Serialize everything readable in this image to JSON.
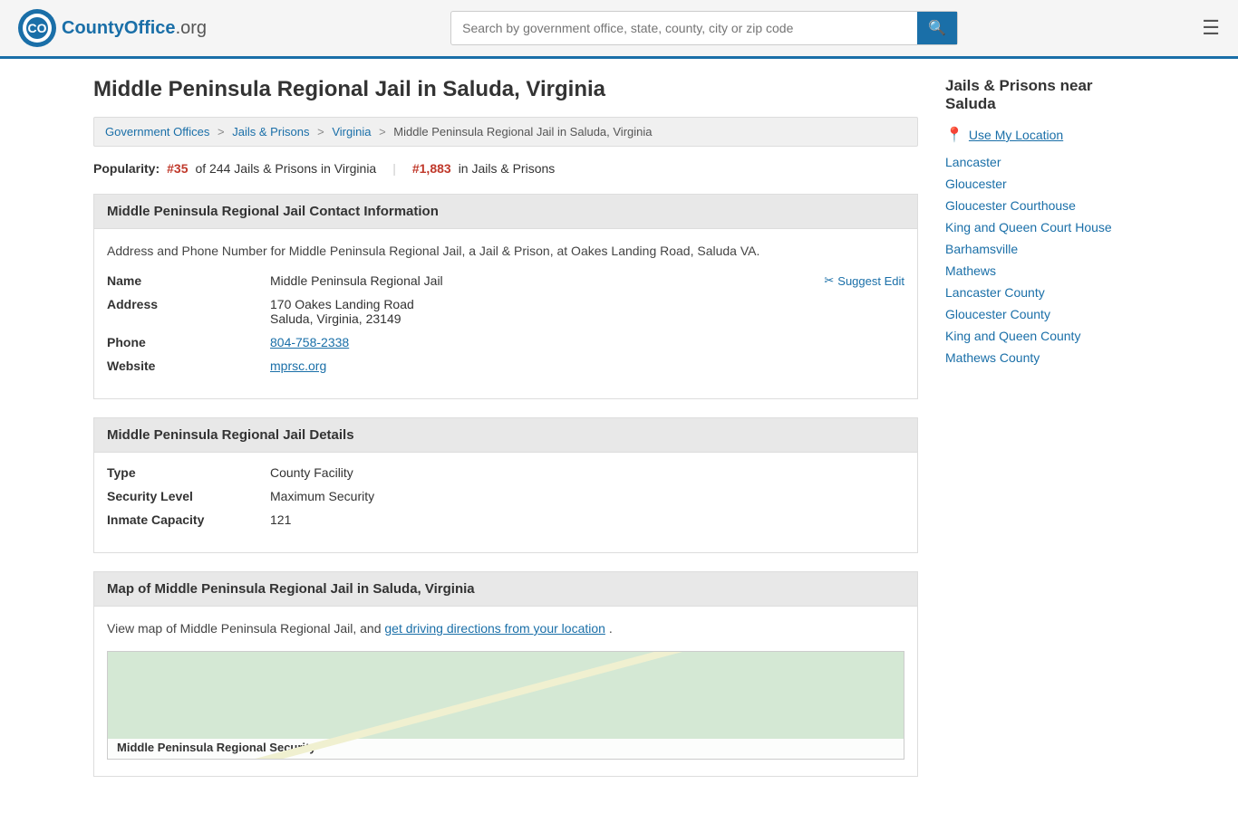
{
  "header": {
    "logo_text": "CountyOffice",
    "logo_suffix": ".org",
    "search_placeholder": "Search by government office, state, county, city or zip code",
    "search_icon": "🔍",
    "menu_icon": "☰"
  },
  "page": {
    "title": "Middle Peninsula Regional Jail in Saluda, Virginia",
    "breadcrumb": {
      "items": [
        {
          "label": "Government Offices",
          "href": "#"
        },
        {
          "label": "Jails & Prisons",
          "href": "#"
        },
        {
          "label": "Virginia",
          "href": "#"
        },
        {
          "label": "Middle Peninsula Regional Jail in Saluda, Virginia",
          "href": "#"
        }
      ]
    },
    "popularity": {
      "label": "Popularity:",
      "rank_number": "#35",
      "rank_text": "of 244 Jails & Prisons in Virginia",
      "rank2_number": "#1,883",
      "rank2_text": "in Jails & Prisons"
    }
  },
  "contact": {
    "section_title": "Middle Peninsula Regional Jail Contact Information",
    "description": "Address and Phone Number for Middle Peninsula Regional Jail, a Jail & Prison, at Oakes Landing Road, Saluda VA.",
    "name_label": "Name",
    "name_value": "Middle Peninsula Regional Jail",
    "address_label": "Address",
    "address_line1": "170 Oakes Landing Road",
    "address_line2": "Saluda, Virginia, 23149",
    "phone_label": "Phone",
    "phone_value": "804-758-2338",
    "website_label": "Website",
    "website_value": "mprsc.org",
    "suggest_edit": "Suggest Edit"
  },
  "details": {
    "section_title": "Middle Peninsula Regional Jail Details",
    "type_label": "Type",
    "type_value": "County Facility",
    "security_label": "Security Level",
    "security_value": "Maximum Security",
    "capacity_label": "Inmate Capacity",
    "capacity_value": "121"
  },
  "map": {
    "section_title": "Map of Middle Peninsula Regional Jail in Saluda, Virginia",
    "description": "View map of Middle Peninsula Regional Jail, and",
    "driving_link": "get driving directions from your location",
    "description_end": ".",
    "map_label": "Middle Peninsula Regional Security"
  },
  "sidebar": {
    "title": "Jails & Prisons near Saluda",
    "use_my_location": "Use My Location",
    "links": [
      "Lancaster",
      "Gloucester",
      "Gloucester Courthouse",
      "King and Queen Court House",
      "Barhamsville",
      "Mathews",
      "Lancaster County",
      "Gloucester County",
      "King and Queen County",
      "Mathews County"
    ]
  }
}
